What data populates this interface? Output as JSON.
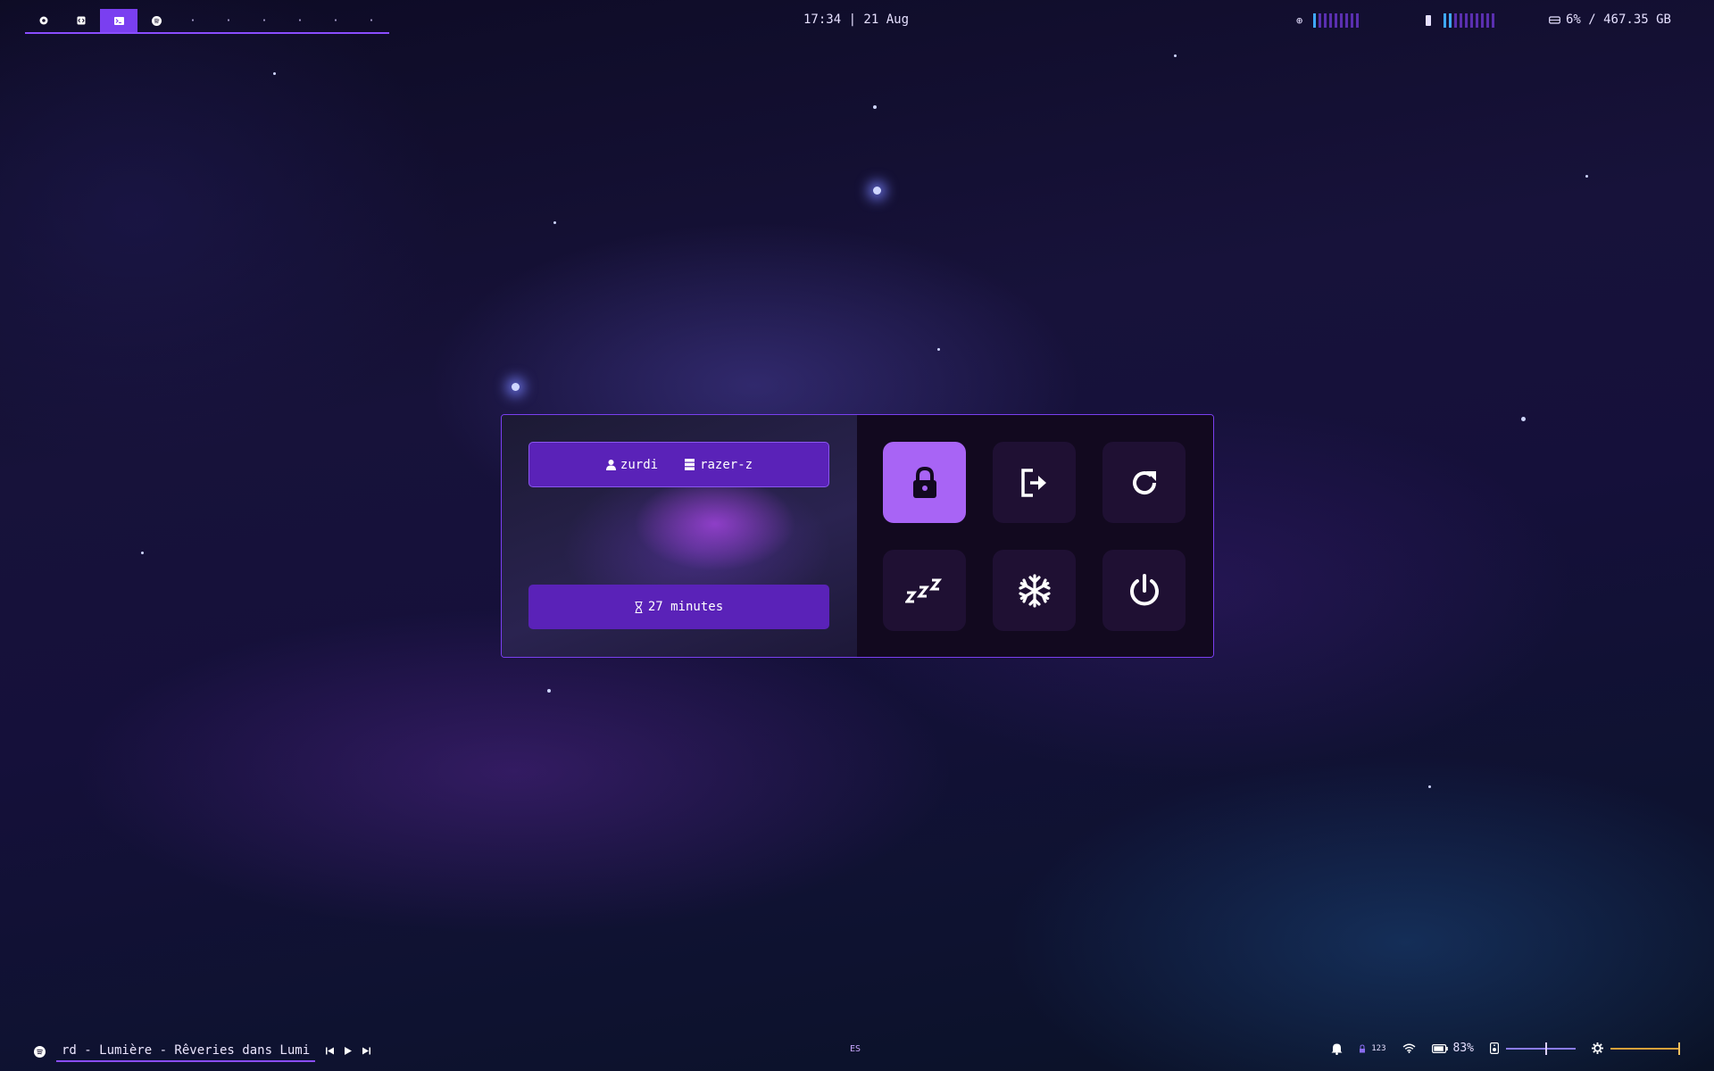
{
  "topbar": {
    "workspaces": [
      {
        "icon": "chrome-icon",
        "active": false
      },
      {
        "icon": "code-icon",
        "active": false
      },
      {
        "icon": "terminal-icon",
        "active": true
      },
      {
        "icon": "spotify-icon",
        "active": false
      }
    ],
    "empty_workspaces": [
      "·",
      "·",
      "·",
      "·",
      "·",
      "·"
    ],
    "clock": "17:34 | 21 Aug",
    "disk": "6% / 467.35 GB"
  },
  "powermenu": {
    "user": "zurdi",
    "host": "razer-z",
    "uptime": "27 minutes",
    "buttons": [
      {
        "name": "lock",
        "icon": "lock-icon",
        "selected": true
      },
      {
        "name": "logout",
        "icon": "logout-icon",
        "selected": false
      },
      {
        "name": "reboot",
        "icon": "reboot-icon",
        "selected": false
      },
      {
        "name": "suspend",
        "icon": "sleep-icon",
        "selected": false
      },
      {
        "name": "hibernate",
        "icon": "snowflake-icon",
        "selected": false
      },
      {
        "name": "shutdown",
        "icon": "power-icon",
        "selected": false
      }
    ]
  },
  "bottombar": {
    "track": "rd - Lumière - Rêveries dans Lumi",
    "keyboard_layout": "ES",
    "battery": "83%",
    "numlock": "123"
  },
  "colors": {
    "accent": "#7a3ff0",
    "panel": "#12091f",
    "button": "#1f1033",
    "selected": "#a864f5"
  }
}
